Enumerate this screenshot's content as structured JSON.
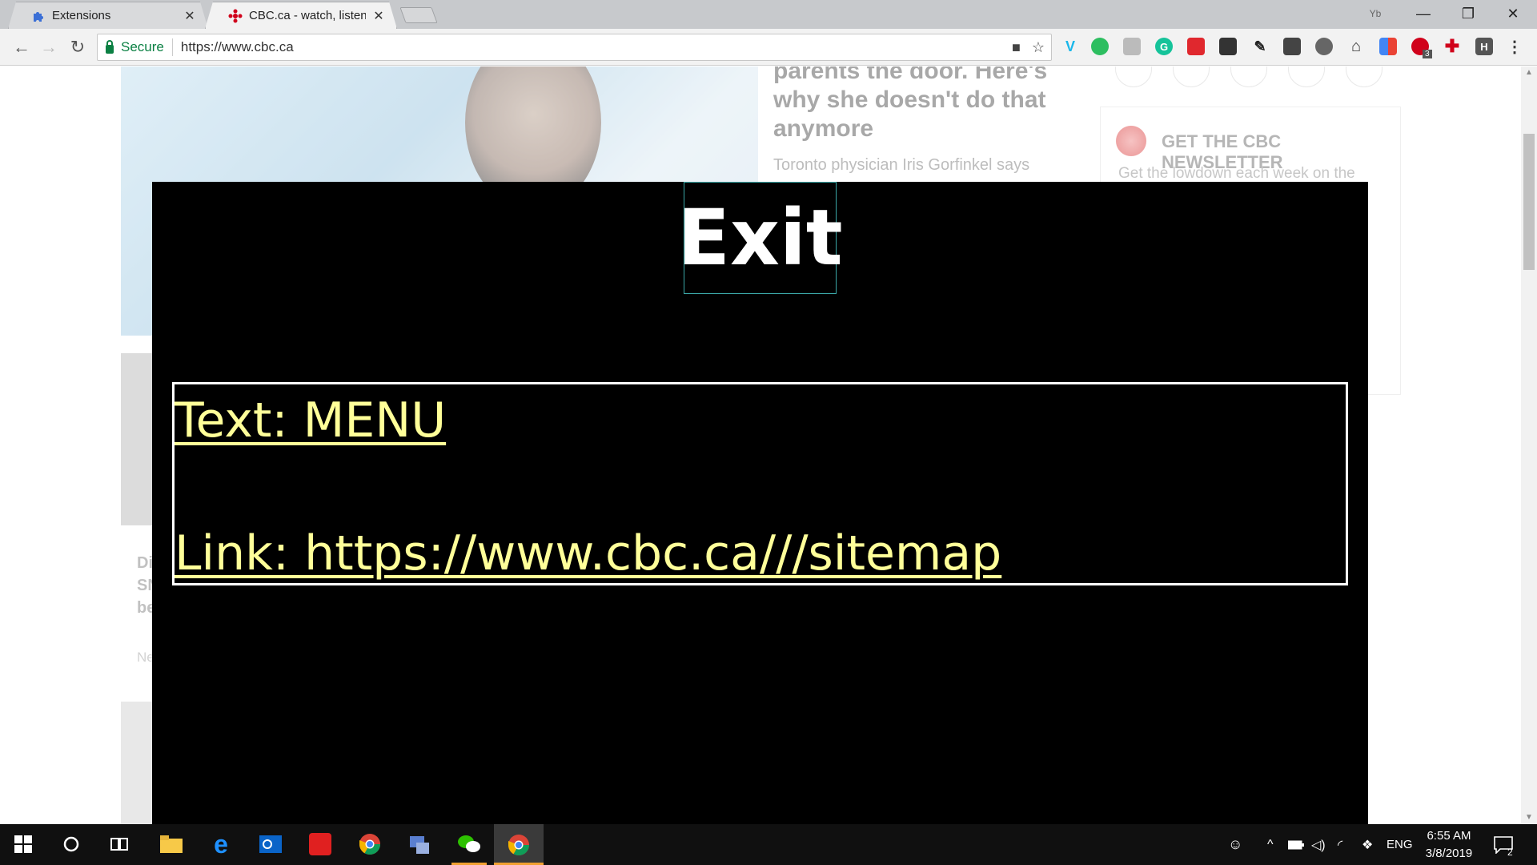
{
  "browser": {
    "tabs": [
      {
        "title": "Extensions",
        "icon": "puzzle-icon",
        "active": false
      },
      {
        "title": "CBC.ca - watch, listen, an",
        "icon": "cbc-gem-icon",
        "active": true
      }
    ],
    "close_glyph": "✕",
    "address": {
      "secure_label": "Secure",
      "url": "https://www.cbc.ca"
    },
    "window_controls": {
      "minimize": "—",
      "restore": "❐",
      "close": "✕"
    },
    "nav": {
      "back": "←",
      "forward": "→",
      "reload": "↻"
    },
    "profile_label": "Yb",
    "extension_badge": "3"
  },
  "page": {
    "headline": "parents the door. Here's why she doesn't do that anymore",
    "subtext": "Toronto physician Iris Gorfinkel says",
    "newsletter": {
      "title": "GET THE CBC NEWSLETTER",
      "text": "Get the lowdown each week on the"
    },
    "card2_text": "Di\nSN\nbe",
    "card2_meta": "Ne"
  },
  "modal": {
    "exit_label": "Exit",
    "text_line": "Text: MENU ",
    "link_line": "Link: https://www.cbc.ca///sitemap",
    "colors": {
      "background": "#000000",
      "link": "#ffff99",
      "border": "#ffffff",
      "exit_border": "#3aa6a6"
    }
  },
  "taskbar": {
    "language": "ENG",
    "time": "6:55 AM",
    "date": "3/8/2019",
    "notification_count": "2"
  }
}
